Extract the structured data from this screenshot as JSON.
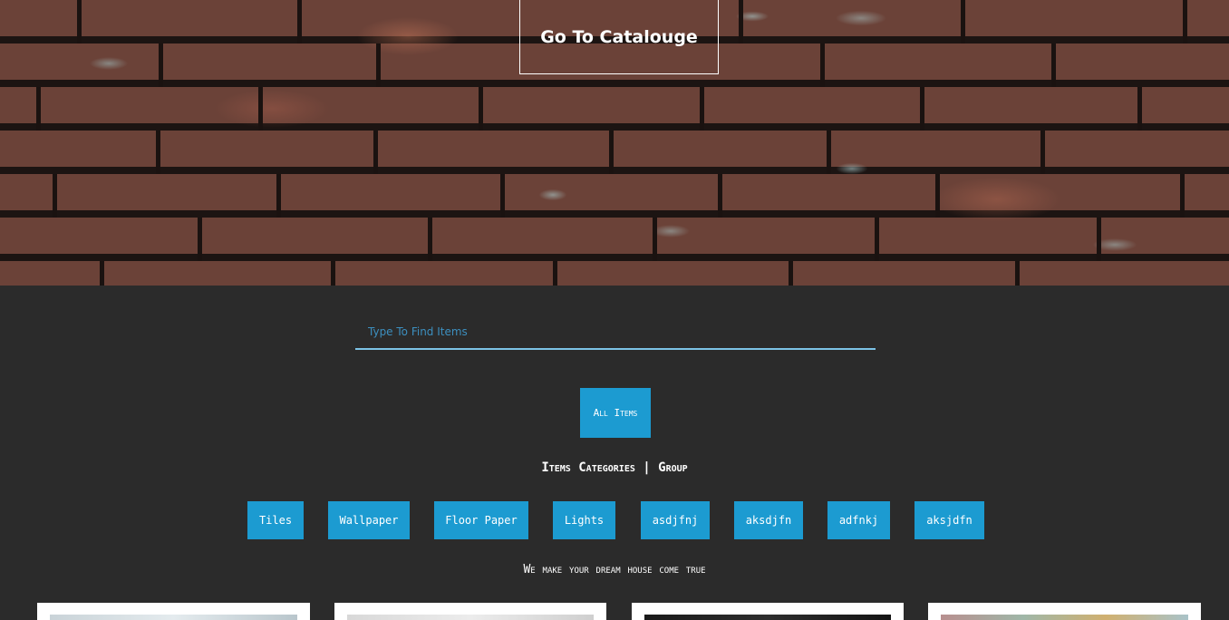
{
  "hero": {
    "catalogue_button": "Go To Catalouge"
  },
  "search": {
    "placeholder": "Type To Find Items",
    "value": ""
  },
  "all_items_button": "All Items",
  "categories": {
    "heading": "Items Categories | Group",
    "items": [
      "Tiles",
      "Wallpaper",
      "Floor Paper",
      "Lights",
      "asdjfnj",
      "aksdjfn",
      "adfnkj",
      "aksjdfn"
    ]
  },
  "tagline": "We make your dream house come true",
  "colors": {
    "accent": "#1c9bd1",
    "background": "#2b2b2b",
    "search_underline": "#7cc3e6"
  }
}
